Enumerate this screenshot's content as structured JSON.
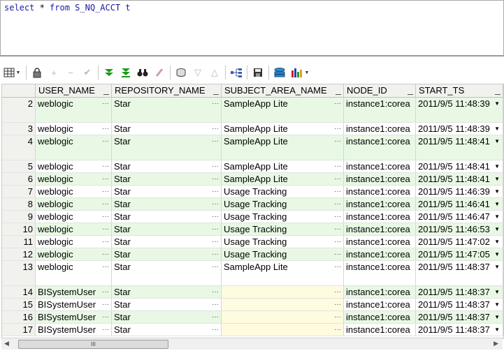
{
  "editor": {
    "sql_kw1": "select",
    "sql_star": " * ",
    "sql_kw2": "from",
    "sql_rest": " S_NQ_ACCT t"
  },
  "toolbar": {
    "icons": [
      "grid-menu-icon",
      "lock-icon",
      "add-row-icon",
      "delete-row-icon",
      "post-changes-icon",
      "fetch-next-icon",
      "fetch-all-icon",
      "find-icon",
      "clear-icon",
      "query-by-example-icon",
      "sort-descending-icon",
      "sort-ascending-icon",
      "link-icon",
      "save-icon",
      "export-icon",
      "chart-icon"
    ]
  },
  "grid": {
    "columns": [
      "USER_NAME",
      "REPOSITORY_NAME",
      "SUBJECT_AREA_NAME",
      "NODE_ID",
      "START_TS"
    ],
    "rows": [
      {
        "n": "2",
        "user": "weblogic",
        "repo": "Star",
        "subject": "SampleApp Lite",
        "node": "instance1:corea",
        "ts": "2011/9/5 11:48:39",
        "tall": true,
        "green": true
      },
      {
        "n": "3",
        "user": "weblogic",
        "repo": "Star",
        "subject": "SampleApp Lite",
        "node": "instance1:corea",
        "ts": "2011/9/5 11:48:39",
        "tall": false,
        "green": false
      },
      {
        "n": "4",
        "user": "weblogic",
        "repo": "Star",
        "subject": "SampleApp Lite",
        "node": "instance1:corea",
        "ts": "2011/9/5 11:48:41",
        "tall": true,
        "green": true
      },
      {
        "n": "5",
        "user": "weblogic",
        "repo": "Star",
        "subject": "SampleApp Lite",
        "node": "instance1:corea",
        "ts": "2011/9/5 11:48:41",
        "tall": false,
        "green": false
      },
      {
        "n": "6",
        "user": "weblogic",
        "repo": "Star",
        "subject": "SampleApp Lite",
        "node": "instance1:corea",
        "ts": "2011/9/5 11:48:41",
        "tall": false,
        "green": true
      },
      {
        "n": "7",
        "user": "weblogic",
        "repo": "Star",
        "subject": "Usage Tracking",
        "node": "instance1:corea",
        "ts": "2011/9/5 11:46:39",
        "tall": false,
        "green": false
      },
      {
        "n": "8",
        "user": "weblogic",
        "repo": "Star",
        "subject": "Usage Tracking",
        "node": "instance1:corea",
        "ts": "2011/9/5 11:46:41",
        "tall": false,
        "green": true
      },
      {
        "n": "9",
        "user": "weblogic",
        "repo": "Star",
        "subject": "Usage Tracking",
        "node": "instance1:corea",
        "ts": "2011/9/5 11:46:47",
        "tall": false,
        "green": false
      },
      {
        "n": "10",
        "user": "weblogic",
        "repo": "Star",
        "subject": "Usage Tracking",
        "node": "instance1:corea",
        "ts": "2011/9/5 11:46:53",
        "tall": false,
        "green": true
      },
      {
        "n": "11",
        "user": "weblogic",
        "repo": "Star",
        "subject": "Usage Tracking",
        "node": "instance1:corea",
        "ts": "2011/9/5 11:47:02",
        "tall": false,
        "green": false
      },
      {
        "n": "12",
        "user": "weblogic",
        "repo": "Star",
        "subject": "Usage Tracking",
        "node": "instance1:corea",
        "ts": "2011/9/5 11:47:05",
        "tall": false,
        "green": true
      },
      {
        "n": "13",
        "user": "weblogic",
        "repo": "Star",
        "subject": "SampleApp Lite",
        "node": "instance1:corea",
        "ts": "2011/9/5 11:48:37",
        "tall": true,
        "green": false
      },
      {
        "n": "14",
        "user": "BISystemUser",
        "repo": "Star",
        "subject": "",
        "node": "instance1:corea",
        "ts": "2011/9/5 11:48:37",
        "tall": false,
        "green": true
      },
      {
        "n": "15",
        "user": "BISystemUser",
        "repo": "Star",
        "subject": "",
        "node": "instance1:corea",
        "ts": "2011/9/5 11:48:37",
        "tall": false,
        "green": false
      },
      {
        "n": "16",
        "user": "BISystemUser",
        "repo": "Star",
        "subject": "",
        "node": "instance1:corea",
        "ts": "2011/9/5 11:48:37",
        "tall": false,
        "green": true
      },
      {
        "n": "17",
        "user": "BISystemUser",
        "repo": "Star",
        "subject": "",
        "node": "instance1:corea",
        "ts": "2011/9/5 11:48:37",
        "tall": false,
        "green": false
      }
    ]
  },
  "scrollbar": {
    "grip": "III"
  }
}
